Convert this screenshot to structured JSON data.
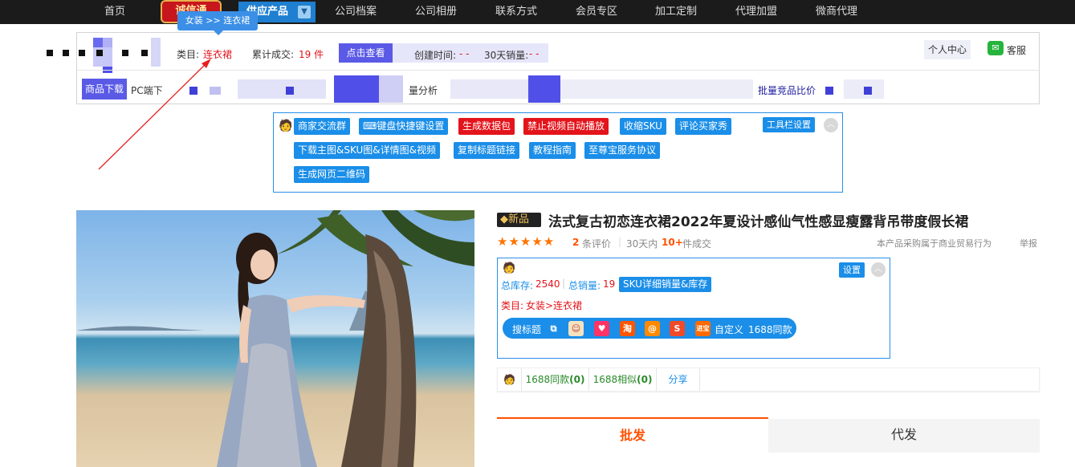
{
  "topnav": {
    "items": [
      "首页",
      "供应产品",
      "公司档案",
      "公司相册",
      "联系方式",
      "会员专区",
      "加工定制",
      "代理加盟",
      "微商代理"
    ],
    "logo_text": "诚信通"
  },
  "tooltip": {
    "text": "女装 >> 连衣裙"
  },
  "infobar": {
    "category_label": "类目:",
    "category_value": "连衣裙",
    "total_sales_label": "累计成交:",
    "total_sales_value": "19 件",
    "check_button": "点击查看",
    "created_label": "创建时间:",
    "created_value": "- -",
    "sales30_label": "30天销量:",
    "sales30_value": "- -",
    "personal_center": "个人中心",
    "customer_service": "客服",
    "row2": {
      "download": "商品下载",
      "pc_download": "PC端下",
      "analysis": "量分析",
      "compare": "批量竞品比价"
    }
  },
  "toolbox": {
    "settings": "工具栏设置",
    "buttons_row1": [
      {
        "label": "商家交流群",
        "style": "blue"
      },
      {
        "label": "⌨键盘快捷键设置",
        "style": "blue"
      },
      {
        "label": "生成数据包",
        "style": "red"
      },
      {
        "label": "禁止视频自动播放",
        "style": "red"
      },
      {
        "label": "收缩SKU",
        "style": "blue"
      },
      {
        "label": "评论买家秀",
        "style": "blue"
      }
    ],
    "buttons_row2": [
      {
        "label": "下载主图&SKU图&详情图&视频",
        "style": "blue"
      },
      {
        "label": "复制标题链接",
        "style": "blue"
      },
      {
        "label": "教程指南",
        "style": "blue"
      },
      {
        "label": "至尊宝服务协议",
        "style": "blue"
      }
    ],
    "buttons_row3": [
      {
        "label": "生成网页二维码",
        "style": "blue"
      }
    ]
  },
  "product": {
    "badge": "新品",
    "title": "法式复古初恋连衣裙2022年夏设计感仙气性感显瘦露背吊带度假长裙",
    "rating_stars": 5,
    "review_count": "2",
    "review_label": "条评价",
    "sales_prefix": "30天内",
    "sales_count": "10+",
    "sales_suffix": "件成交",
    "trade_note": "本产品采购属于商业贸易行为",
    "report": "举报"
  },
  "infobox2": {
    "settings": "设置",
    "stock_label": "总库存:",
    "stock_value": "2540",
    "sold_label": "总销量:",
    "sold_value": "19",
    "sku_button": "SKU详细销量&库存",
    "category_label": "类目:",
    "category_value": "女装>连衣裙",
    "search_label": "搜标题",
    "custom": "自定义",
    "same_1688": "1688同款"
  },
  "samebar": {
    "same": "1688同款",
    "same_count": "(0)",
    "similar": "1688相似",
    "similar_count": "(0)",
    "share": "分享"
  },
  "tabs": {
    "wholesale": "批发",
    "dropship": "代发"
  },
  "colors": {
    "accent_blue": "#1a8ee8",
    "accent_red": "#e3141b",
    "orange": "#ff5000"
  }
}
